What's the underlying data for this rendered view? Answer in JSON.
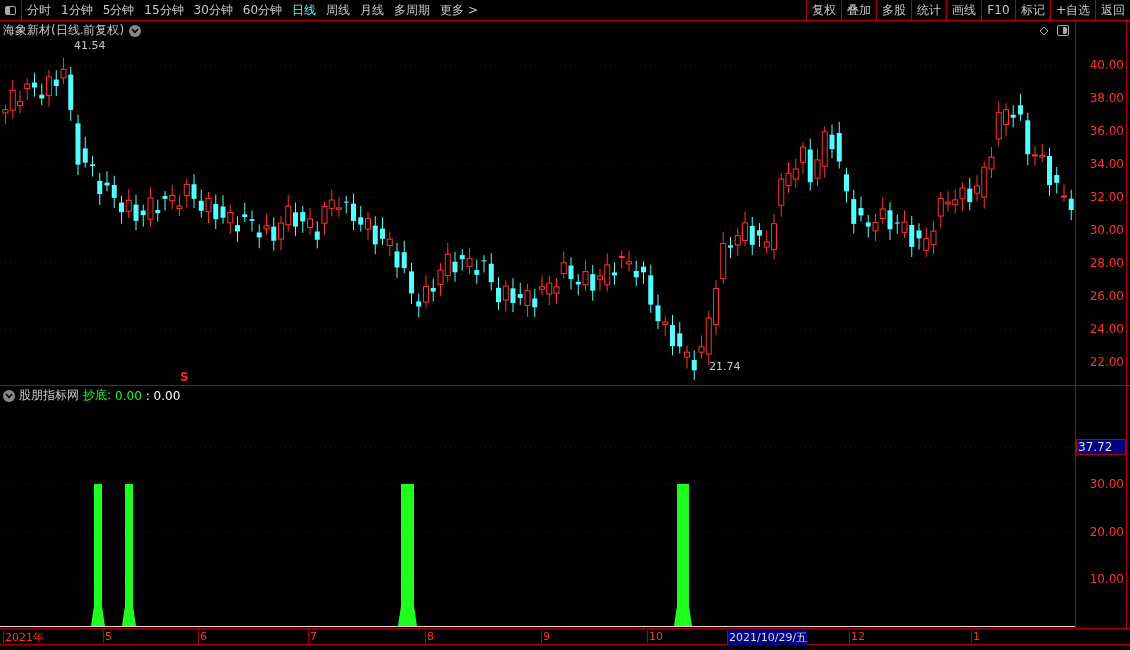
{
  "toolbar": {
    "periods": [
      {
        "label": "分时",
        "selected": false
      },
      {
        "label": "1分钟",
        "selected": false
      },
      {
        "label": "5分钟",
        "selected": false
      },
      {
        "label": "15分钟",
        "selected": false
      },
      {
        "label": "30分钟",
        "selected": false
      },
      {
        "label": "60分钟",
        "selected": false
      },
      {
        "label": "日线",
        "selected": true
      },
      {
        "label": "周线",
        "selected": false
      },
      {
        "label": "月线",
        "selected": false
      },
      {
        "label": "多周期",
        "selected": false
      },
      {
        "label": "更多 >",
        "selected": false
      }
    ],
    "buttons": [
      "复权",
      "叠加",
      "多股",
      "统计",
      "画线",
      "F10",
      "标记",
      "+自选",
      "返回"
    ]
  },
  "main_chart": {
    "title": "海象新材(日线.前复权)",
    "high_label": "41.54",
    "low_label": "21.74",
    "signal_mark": "S",
    "yticks": [
      "40.00",
      "38.00",
      "36.00",
      "34.00",
      "32.00",
      "30.00",
      "28.00",
      "26.00",
      "24.00",
      "22.00"
    ]
  },
  "indicator": {
    "name": "股朋指标网",
    "signal_label": "抄底:",
    "signal_value": "0.00",
    "second_value": ": 0.00",
    "cursor_value": "37.72",
    "yticks": [
      "30.00",
      "20.00",
      "10.00"
    ]
  },
  "x_axis": [
    {
      "label": "2021年",
      "kind": "date"
    },
    {
      "label": "5",
      "kind": "date"
    },
    {
      "label": "6",
      "kind": "date"
    },
    {
      "label": "7",
      "kind": "date"
    },
    {
      "label": "8",
      "kind": "date"
    },
    {
      "label": "9",
      "kind": "date"
    },
    {
      "label": "10",
      "kind": "date"
    },
    {
      "label": "2021/10/29/五",
      "kind": "cursor"
    },
    {
      "label": "12",
      "kind": "date"
    },
    {
      "label": "1",
      "kind": "date"
    }
  ]
}
